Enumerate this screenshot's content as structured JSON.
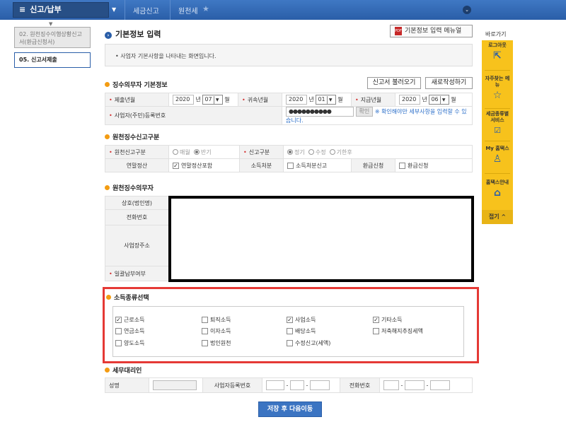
{
  "topbar": {
    "menu_label": "신고/납부",
    "crumb1": "세금신고",
    "crumb2": "원천세"
  },
  "steps": {
    "step1": "02. 원천징수이행상황신고서(환급신청서)",
    "step2": "05. 신고서제출"
  },
  "main": {
    "title": "기본정보 입력",
    "manual_button": "기본정보 입력 메뉴얼",
    "description": "사업자 기본사항을 나타내는 화면입니다."
  },
  "withholder": {
    "section_title": "징수의무자 기본정보",
    "load_button": "신고서 불러오기",
    "new_button": "새로작성하기",
    "submit_ym_label": "제출년월",
    "submit_year": "2020",
    "submit_month": "07",
    "belong_ym_label": "귀속년월",
    "belong_year": "2020",
    "belong_month": "01",
    "pay_ym_label": "지급년월",
    "pay_year": "2020",
    "pay_month": "06",
    "year_unit": "년",
    "month_unit": "월",
    "bizno_label": "사업자(주민)등록번호",
    "bizno_value": "●●●●●●●●●●",
    "confirm_button": "확인",
    "confirm_hint": "※ 확인해야만 세부사항을 입력할 수 있습니다."
  },
  "report_type": {
    "section_title": "원천징수신고구분",
    "type_label": "원천신고구분",
    "opt_monthly": "매월",
    "opt_half": "반기",
    "kind_label": "신고구분",
    "opt_regular": "정기",
    "opt_amend": "수정",
    "opt_late": "기한후",
    "yearend_label": "연말정산",
    "yearend_check": "연말정산포함",
    "disposal_label": "소득처분",
    "disposal_check": "소득처분신고",
    "refund_label": "환급신청",
    "refund_check": "환급신청"
  },
  "agent": {
    "section_title": "원천징수의무자",
    "name_label": "상호(법인명)",
    "phone_label": "전화번호",
    "address_label": "사업장주소",
    "lump_label": "일괄납부여부"
  },
  "income": {
    "section_title": "소득종류선택",
    "items": [
      {
        "label": "근로소득",
        "checked": true
      },
      {
        "label": "퇴직소득",
        "checked": false
      },
      {
        "label": "사업소득",
        "checked": true
      },
      {
        "label": "기타소득",
        "checked": true
      },
      {
        "label": "연금소득",
        "checked": false
      },
      {
        "label": "이자소득",
        "checked": false
      },
      {
        "label": "배당소득",
        "checked": false
      },
      {
        "label": "저축해지추징세액",
        "checked": false
      },
      {
        "label": "양도소득",
        "checked": false
      },
      {
        "label": "법인원천",
        "checked": false
      },
      {
        "label": "수정신고(세액)",
        "checked": false
      }
    ]
  },
  "tax_agent": {
    "section_title": "세무대리인",
    "name_label": "성명",
    "bizno_label": "사업자등록번호",
    "phone_label": "전화번호",
    "dash": "-"
  },
  "footer": {
    "save_button": "저장 후 다음이동"
  },
  "quickbar": {
    "title": "바로가기",
    "logout": "로그아웃",
    "faq": "자주찾는 메뉴",
    "tax_service": "세금종류별 서비스",
    "my_hometax": "My 홈택스",
    "guide": "홈택스안내",
    "close": "접기"
  },
  "colors": {
    "topbar": "#2a5ea8",
    "accent": "#f39c12",
    "highlight": "#e53935",
    "quickbar": "#f7c21c"
  }
}
